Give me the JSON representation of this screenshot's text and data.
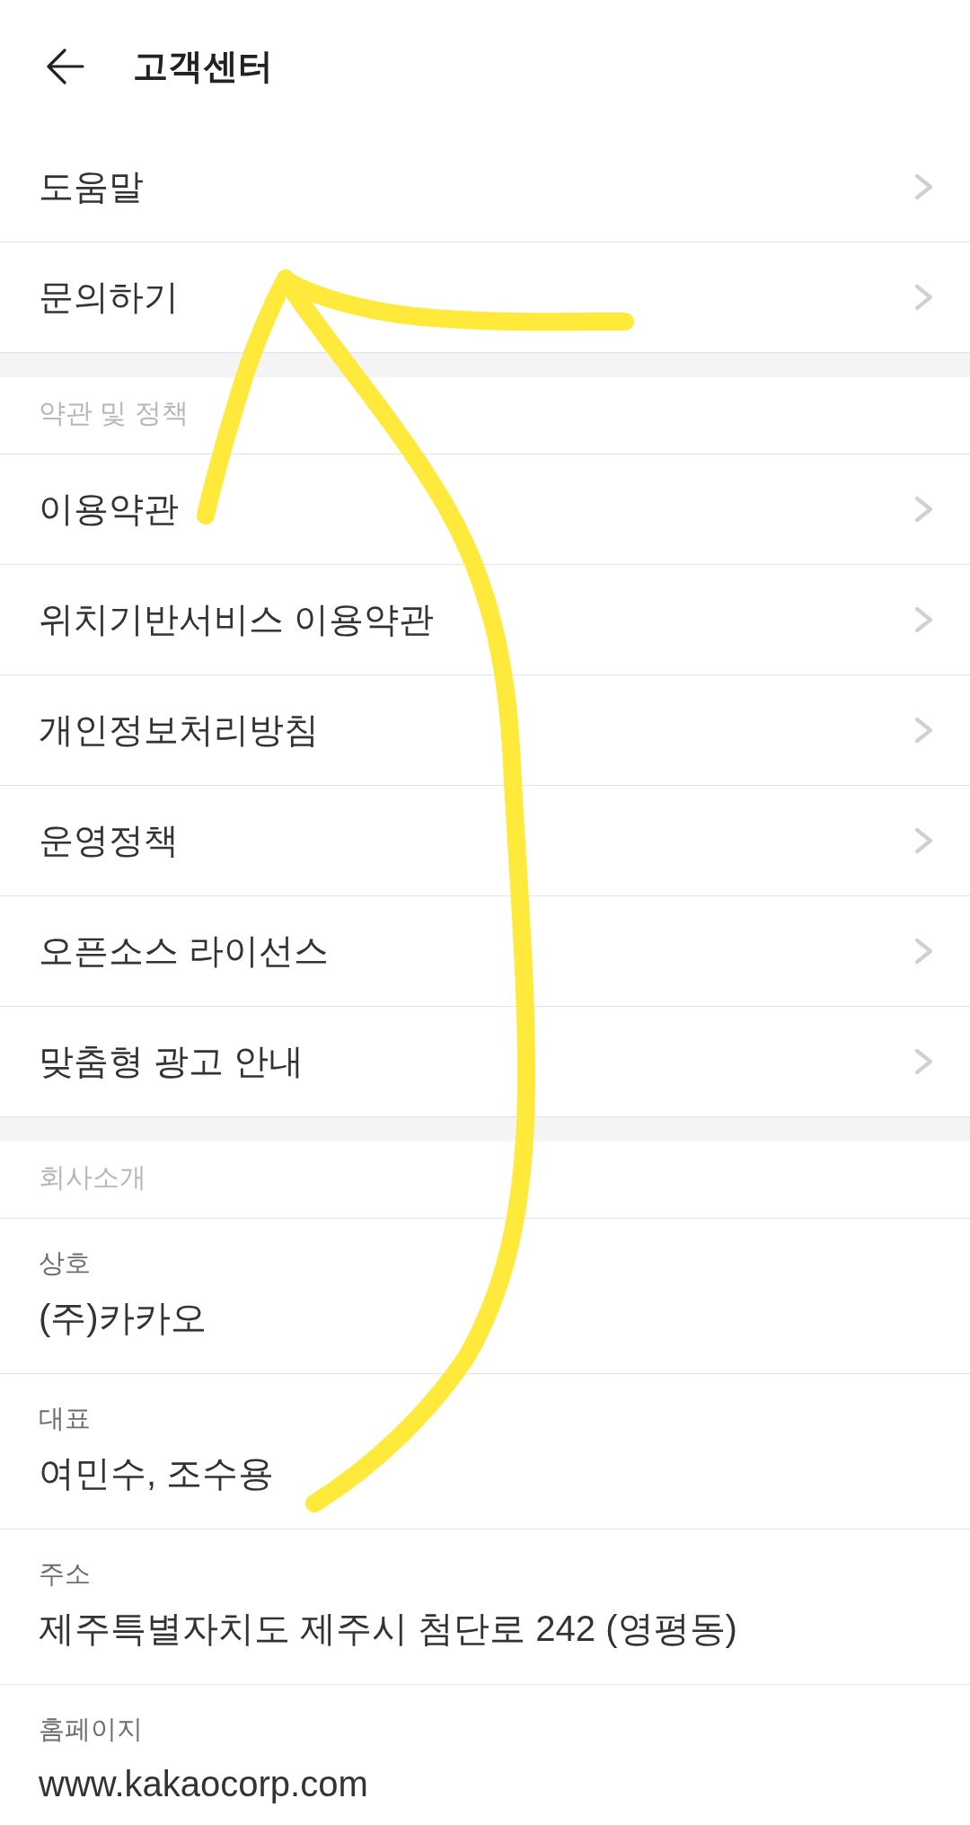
{
  "header": {
    "title": "고객센터"
  },
  "support_menu": [
    {
      "label": "도움말"
    },
    {
      "label": "문의하기"
    }
  ],
  "terms_section": {
    "title": "약관 및 정책",
    "items": [
      {
        "label": "이용약관"
      },
      {
        "label": "위치기반서비스 이용약관"
      },
      {
        "label": "개인정보처리방침"
      },
      {
        "label": "운영정책"
      },
      {
        "label": "오픈소스 라이선스"
      },
      {
        "label": "맞춤형 광고 안내"
      }
    ]
  },
  "company_section": {
    "title": "회사소개",
    "fields": [
      {
        "label": "상호",
        "value": "(주)카카오"
      },
      {
        "label": "대표",
        "value": "여민수, 조수용"
      },
      {
        "label": "주소",
        "value": "제주특별자치도 제주시 첨단로 242 (영평동)"
      },
      {
        "label": "홈페이지",
        "value": "www.kakaocorp.com"
      }
    ]
  }
}
